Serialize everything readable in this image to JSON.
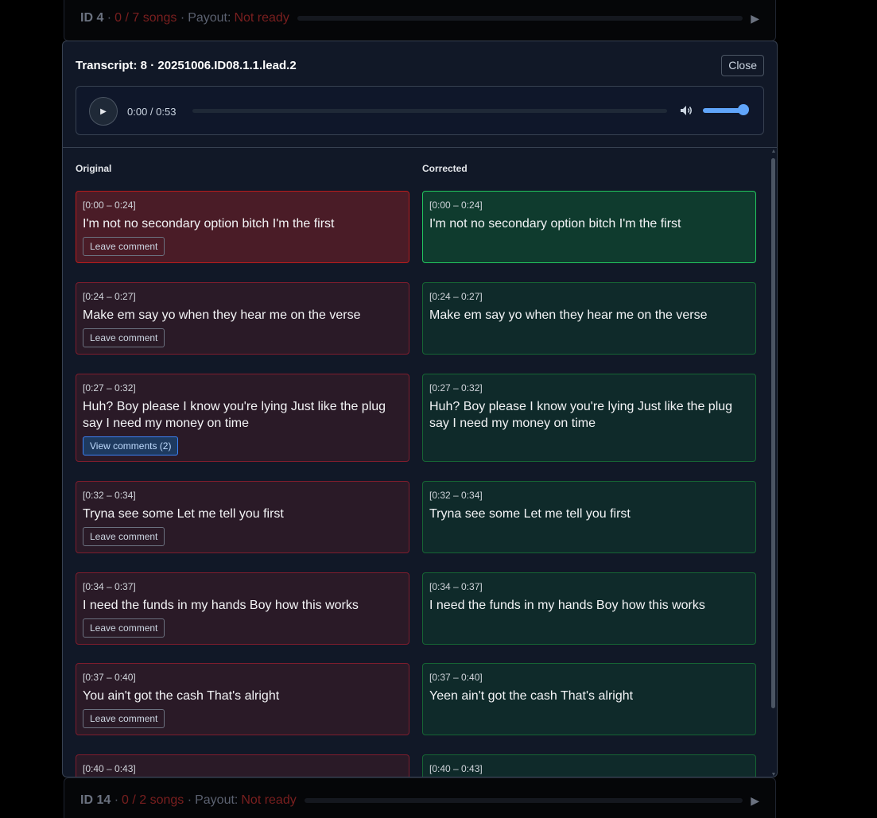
{
  "background_rows": [
    {
      "id": "ID 4",
      "songs": "0 / 7 songs",
      "payout_label": "Payout:",
      "payout_status": "Not ready"
    },
    {
      "id": "ID 14",
      "songs": "0 / 2 songs",
      "payout_label": "Payout:",
      "payout_status": "Not ready"
    }
  ],
  "modal": {
    "title": "Transcript: 8 · 20251006.ID08.1.1.lead.2",
    "close_label": "Close",
    "player": {
      "time": "0:00 / 0:53",
      "volume": 1.0
    }
  },
  "columns": {
    "original": "Original",
    "corrected": "Corrected"
  },
  "segments": [
    {
      "time": "[0:00 – 0:24]",
      "original": "I'm not no secondary option bitch I'm the first",
      "corrected": "I'm not no secondary option bitch I'm the first",
      "button": "Leave comment"
    },
    {
      "time": "[0:24 – 0:27]",
      "original": "Make em say yo when they hear me on the verse",
      "corrected": "Make em say yo when they hear me on the verse",
      "button": "Leave comment"
    },
    {
      "time": "[0:27 – 0:32]",
      "original": "Huh? Boy please I know you're lying Just like the plug say I need my money on time",
      "corrected": "Huh? Boy please I know you're lying Just like the plug say I need my money on time",
      "button": "View comments (2)"
    },
    {
      "time": "[0:32 – 0:34]",
      "original": "Tryna see some Let me tell you first",
      "corrected": "Tryna see some Let me tell you first",
      "button": "Leave comment"
    },
    {
      "time": "[0:34 – 0:37]",
      "original": "I need the funds in my hands Boy how this works",
      "corrected": "I need the funds in my hands Boy how this works",
      "button": "Leave comment"
    },
    {
      "time": "[0:37 – 0:40]",
      "original": "You ain't got the cash That's alright",
      "corrected": "Yeen ain't got the cash That's alright",
      "button": "Leave comment"
    },
    {
      "time": "[0:40 – 0:43]",
      "original": "",
      "corrected": "",
      "button": ""
    }
  ]
}
